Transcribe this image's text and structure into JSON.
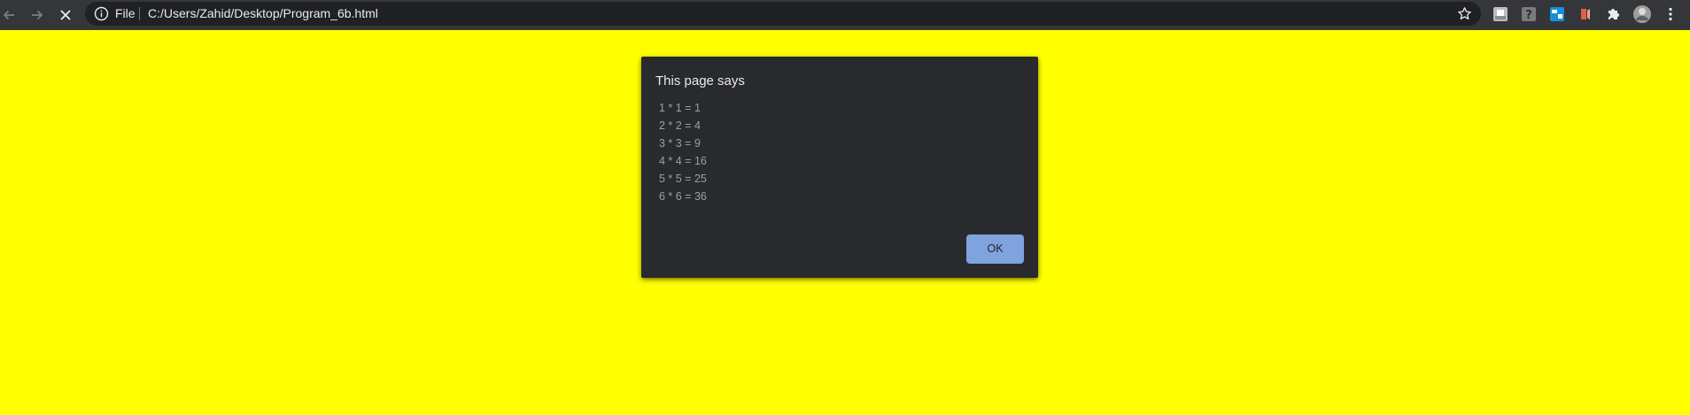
{
  "toolbar": {
    "back_icon": "back-arrow-icon",
    "forward_icon": "forward-arrow-icon",
    "stop_icon": "stop-loading-icon",
    "omnibox": {
      "scheme_label": "File",
      "url": "C:/Users/Zahid/Desktop/Program_6b.html",
      "info_icon": "info-icon",
      "bookmark_icon": "star-icon"
    },
    "extensions": [
      "extension-1-icon",
      "extension-2-icon",
      "extension-3-icon",
      "extension-4-icon",
      "puzzle-icon",
      "profile-avatar",
      "menu-dots-icon"
    ]
  },
  "page": {
    "background": "#ffff00"
  },
  "dialog": {
    "title": "This page says",
    "lines": [
      "1 * 1 = 1",
      "2 * 2 = 4",
      "3 * 3 = 9",
      "4 * 4 = 16",
      "5 * 5 = 25",
      "6 * 6 = 36"
    ],
    "ok_label": "OK"
  }
}
